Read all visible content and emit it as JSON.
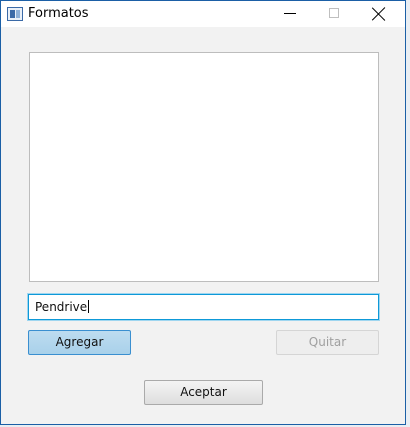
{
  "window": {
    "title": "Formatos"
  },
  "list": {
    "items": []
  },
  "input": {
    "value": "Pendrive"
  },
  "buttons": {
    "add_label": "Agregar",
    "remove_label": "Quitar",
    "accept_label": "Aceptar"
  },
  "icons": {
    "app": "app-window-icon",
    "minimize": "minimize-icon",
    "maximize": "maximize-icon",
    "close": "close-icon"
  },
  "colors": {
    "focus_border": "#0e99d8",
    "add_button_bg": "#b6d9ef",
    "disabled_text": "#a0a0a0"
  }
}
